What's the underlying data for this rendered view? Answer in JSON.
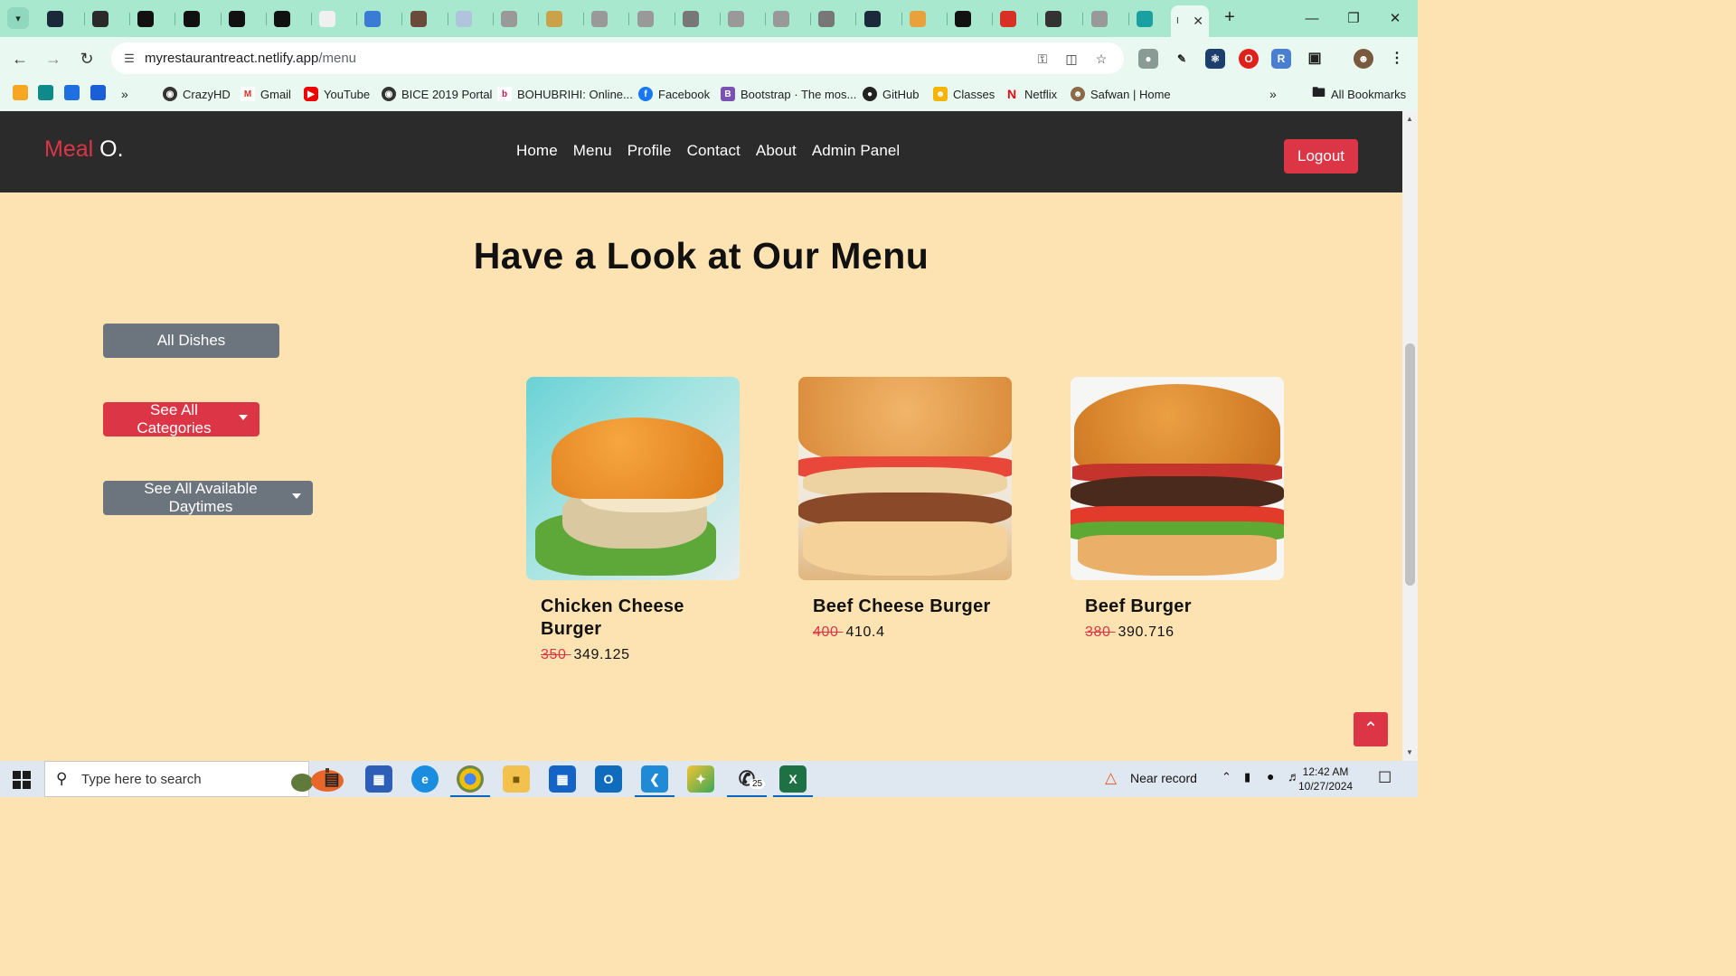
{
  "browser": {
    "active_tab_label": "I",
    "url_domain": "myrestaurantreact.netlify.app",
    "url_path": "/menu",
    "bookmarks": [
      "CrazyHD",
      "Gmail",
      "YouTube",
      "BICE 2019 Portal",
      "BOHUBRIHI: Online...",
      "Facebook",
      "Bootstrap · The mos...",
      "GitHub",
      "Classes",
      "Netflix",
      "Safwan | Home"
    ],
    "all_bookmarks_label": "All Bookmarks"
  },
  "navbar": {
    "brand_part1": "Meal",
    "brand_part2": " O.",
    "links": [
      "Home",
      "Menu",
      "Profile",
      "Contact",
      "About",
      "Admin Panel"
    ],
    "logout_label": "Logout"
  },
  "menu": {
    "title": "Have a Look at Our Menu",
    "filters": {
      "all_dishes": "All Dishes",
      "categories": "See All Categories",
      "daytimes": "See All Available Daytimes"
    },
    "dishes": [
      {
        "name": "Chicken Cheese Burger",
        "old_price": "350 ",
        "price": "349.125"
      },
      {
        "name": "Beef Cheese Burger",
        "old_price": "400 ",
        "price": "410.4"
      },
      {
        "name": "Beef Burger",
        "old_price": "380 ",
        "price": "390.716"
      }
    ]
  },
  "taskbar": {
    "search_placeholder": "Type here to search",
    "weather": "Near record",
    "time": "12:42 AM",
    "date": "10/27/2024",
    "whatsapp_badge": "25"
  },
  "colors": {
    "accent_red": "#dc3545",
    "secondary_gray": "#6c757d",
    "page_bg": "#fde3b2",
    "navbar_bg": "#2b2b2b",
    "chrome_bg": "#a8e8cf"
  }
}
